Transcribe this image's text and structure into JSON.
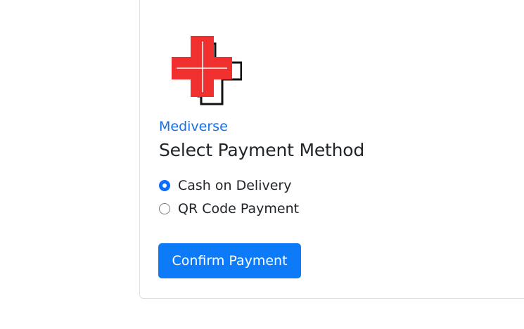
{
  "brand": {
    "name": "Mediverse",
    "logo_icon": "medical-cross-icon",
    "accent_color": "#1a6fe6",
    "logo_color": "#f0302e"
  },
  "payment": {
    "heading": "Select Payment Method",
    "options": [
      {
        "label": "Cash on Delivery",
        "selected": true
      },
      {
        "label": "QR Code Payment",
        "selected": false
      }
    ],
    "confirm_label": "Confirm Payment",
    "button_color": "#0d7bf7"
  }
}
